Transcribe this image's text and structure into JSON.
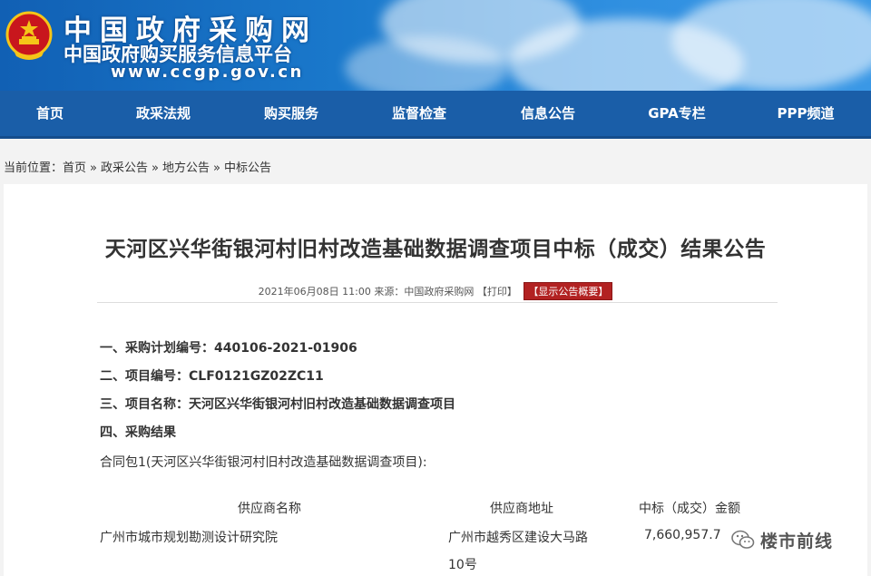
{
  "header": {
    "title": "中国政府采购网",
    "subtitle": "中国政府购买服务信息平台",
    "url": "www.ccgp.gov.cn"
  },
  "nav": {
    "items": [
      {
        "label": "首页"
      },
      {
        "label": "政采法规"
      },
      {
        "label": "购买服务"
      },
      {
        "label": "监督检查"
      },
      {
        "label": "信息公告"
      },
      {
        "label": "GPA专栏"
      },
      {
        "label": "PPP频道"
      }
    ]
  },
  "breadcrumb": {
    "prefix": "当前位置：",
    "items": [
      "首页",
      "政采公告",
      "地方公告",
      "中标公告"
    ],
    "separator": "»"
  },
  "article": {
    "title": "天河区兴华街银河村旧村改造基础数据调查项目中标（成交）结果公告",
    "meta": {
      "date": "2021年06月08日 11:00",
      "source_label": "来源：",
      "source": "中国政府采购网",
      "print": "【打印】",
      "summary_button": "【显示公告概要】"
    },
    "sections": [
      "一、采购计划编号：440106-2021-01906",
      "二、项目编号：CLF0121GZ02ZC11",
      "三、项目名称：天河区兴华街银河村旧村改造基础数据调查项目",
      "四、采购结果"
    ],
    "package": "合同包1(天河区兴华街银河村旧村改造基础数据调查项目):",
    "table": {
      "headers": [
        "供应商名称",
        "供应商地址",
        "中标（成交）金额"
      ],
      "row": {
        "name": "广州市城市规划勘测设计研究院",
        "address_line1": "广州市越秀区建设大马路",
        "address_line2": "10号",
        "amount": "7,660,957.7"
      }
    }
  },
  "watermark": {
    "text": "楼市前线",
    "icon": "wechat-icon"
  },
  "colors": {
    "header_blue": "#1a79cc",
    "nav_blue": "#1a5ea8",
    "summary_red": "#b22222"
  }
}
